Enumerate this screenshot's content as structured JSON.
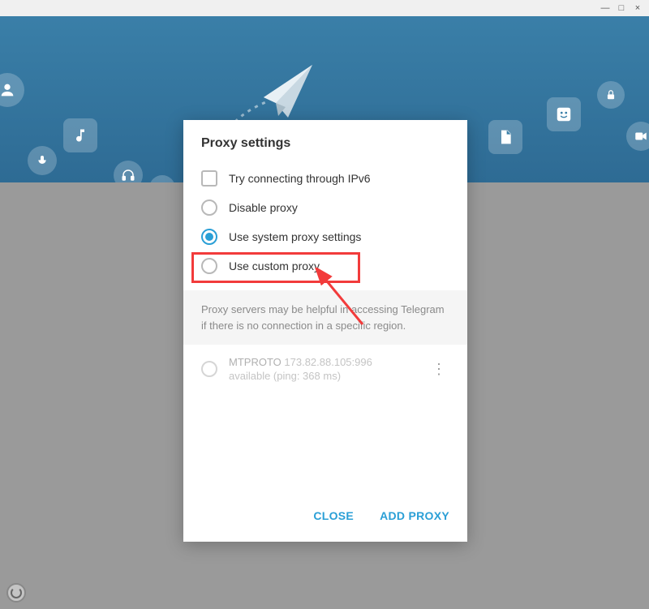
{
  "titleBar": {
    "minimize": "—",
    "maximize": "□",
    "close": "×"
  },
  "dialog": {
    "title": "Proxy settings",
    "options": {
      "ipv6": "Try connecting through IPv6",
      "disable": "Disable proxy",
      "system": "Use system proxy settings",
      "custom": "Use custom proxy"
    },
    "info": "Proxy servers may be helpful in accessing Telegram if there is no connection in a specific region.",
    "proxyEntry": {
      "protocol": "MTPROTO",
      "address": "173.82.88.105:996",
      "status": "available (ping: 368 ms)"
    },
    "buttons": {
      "close": "CLOSE",
      "addProxy": "ADD PROXY"
    }
  }
}
